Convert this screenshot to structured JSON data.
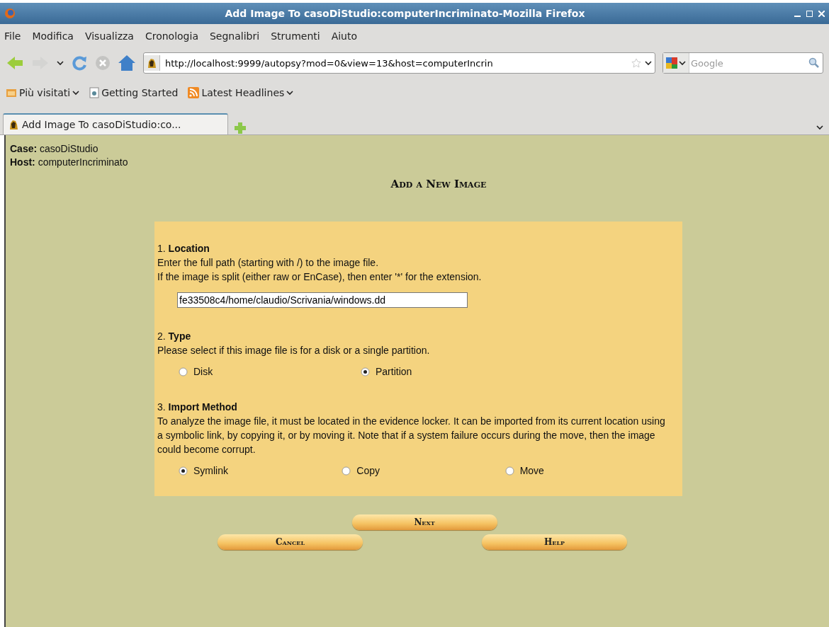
{
  "window": {
    "title": "Add Image To casoDiStudio:computerIncriminato-Mozilla Firefox"
  },
  "menu": [
    "File",
    "Modifica",
    "Visualizza",
    "Cronologia",
    "Segnalibri",
    "Strumenti",
    "Aiuto"
  ],
  "address_bar": {
    "value": "http://localhost:9999/autopsy?mod=0&view=13&host=computerIncrin"
  },
  "search": {
    "placeholder": "Google"
  },
  "bookmarks": [
    {
      "label": "Più visitati",
      "kind": "folder"
    },
    {
      "label": "Getting Started",
      "kind": "page"
    },
    {
      "label": "Latest Headlines",
      "kind": "feed"
    }
  ],
  "tabs": [
    {
      "label": "Add Image To casoDiStudio:co...",
      "selected": true
    }
  ],
  "info": [
    {
      "label": "Case:",
      "value": "casoDiStudio"
    },
    {
      "label": "Host:",
      "value": "computerIncriminato"
    }
  ],
  "heading": "Add a New Image",
  "sections": [
    {
      "number": "1.",
      "title": "Location",
      "description": "Enter the full path (starting with /) to the image file.\nIf the image is split (either raw or EnCase), then enter '*' for the extension.",
      "kind": "text",
      "value": "fe33508c4/home/claudio/Scrivania/windows.dd"
    },
    {
      "number": "2.",
      "title": "Type",
      "description": "Please select if this image file is for a disk or a single partition.",
      "kind": "radio",
      "options": [
        {
          "label": "Disk",
          "selected": false
        },
        {
          "label": "Partition",
          "selected": true
        }
      ]
    },
    {
      "number": "3.",
      "title": "Import Method",
      "description": "To analyze the image file, it must be located in the evidence locker. It can be imported from its current location using a symbolic link, by copying it, or by moving it. Note that if a system failure occurs during the move, then the image could become corrupt.",
      "kind": "radio",
      "options": [
        {
          "label": "Symlink",
          "selected": true
        },
        {
          "label": "Copy",
          "selected": false
        },
        {
          "label": "Move",
          "selected": false
        }
      ]
    }
  ],
  "buttons": {
    "next": "Next",
    "cancel": "Cancel",
    "help": "Help"
  }
}
